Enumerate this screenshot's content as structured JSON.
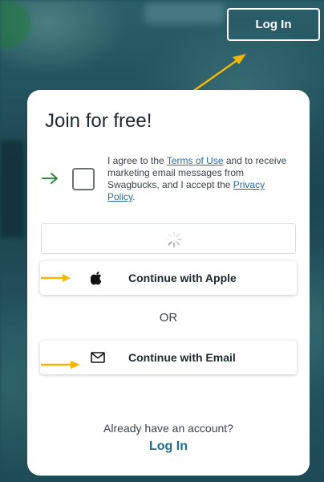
{
  "header": {
    "login_label": "Log In"
  },
  "signup_card": {
    "title": "Join for free!",
    "consent": {
      "text_part1": "I agree to the ",
      "terms_link": "Terms of Use",
      "text_part2": " and to receive marketing email messages from Swagbucks, and I accept the ",
      "privacy_link": "Privacy Policy",
      "text_part3": "."
    },
    "apple_button": {
      "label": "Continue with Apple",
      "icon": "apple-icon"
    },
    "or_divider": "OR",
    "email_button": {
      "label": "Continue with Email",
      "icon": "envelope-icon"
    },
    "already_have_account": "Already have an account?",
    "login_link": "Log In"
  },
  "colors": {
    "background": "#1d4a55",
    "card": "#ffffff",
    "link": "#1f6f8c",
    "annotation_arrow_yellow": "#f2b705",
    "annotation_arrow_green": "#2e8b3e"
  }
}
